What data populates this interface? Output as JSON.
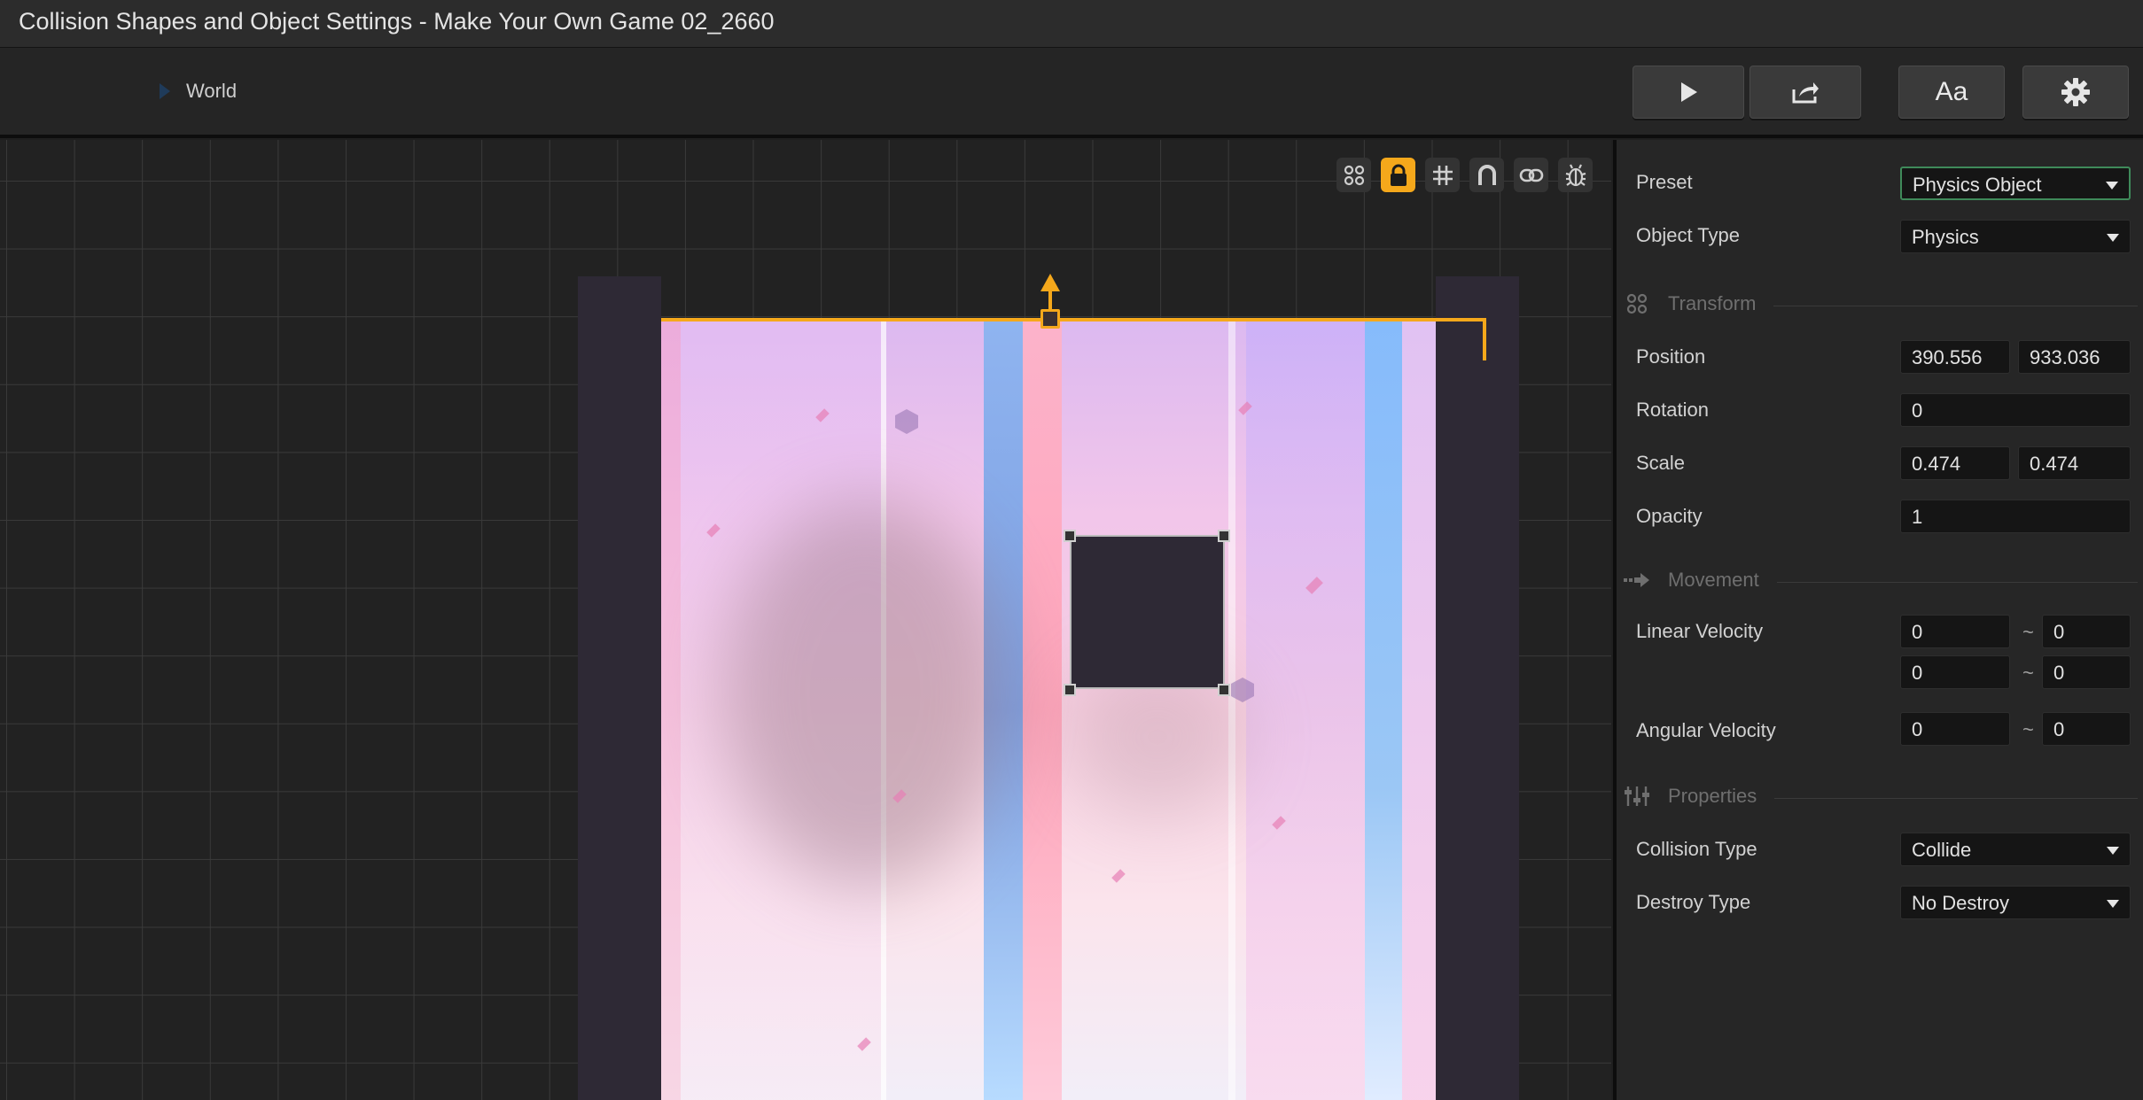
{
  "window": {
    "title": "Collision Shapes and Object Settings - Make Your Own Game 02_2660"
  },
  "toolbar": {
    "breadcrumb": "World",
    "play_icon": "play-icon",
    "share_icon": "share-icon",
    "font_button_label": "Aa",
    "settings_icon": "gear-icon"
  },
  "canvas": {
    "tools": [
      "nodes-icon",
      "lock-icon",
      "grid-icon",
      "magnet-icon",
      "link-icon",
      "bug-icon"
    ],
    "active_tool": "lock-icon",
    "selection_color": "#f5a81b"
  },
  "inspector": {
    "preset": {
      "label": "Preset",
      "value": "Physics Object"
    },
    "object_type": {
      "label": "Object Type",
      "value": "Physics"
    },
    "transform": {
      "title": "Transform",
      "position": {
        "label": "Position",
        "x": "390.556",
        "y": "933.036"
      },
      "rotation": {
        "label": "Rotation",
        "value": "0"
      },
      "scale": {
        "label": "Scale",
        "x": "0.474",
        "y": "0.474"
      },
      "opacity": {
        "label": "Opacity",
        "value": "1"
      }
    },
    "movement": {
      "title": "Movement",
      "linear_velocity": {
        "label": "Linear Velocity",
        "x_min": "0",
        "x_max": "0",
        "y_min": "0",
        "y_max": "0"
      },
      "angular_velocity": {
        "label": "Angular Velocity",
        "min": "0",
        "max": "0"
      },
      "range_sep": "~"
    },
    "properties": {
      "title": "Properties",
      "collision_type": {
        "label": "Collision Type",
        "value": "Collide"
      },
      "destroy_type": {
        "label": "Destroy Type",
        "value": "No Destroy"
      }
    }
  }
}
